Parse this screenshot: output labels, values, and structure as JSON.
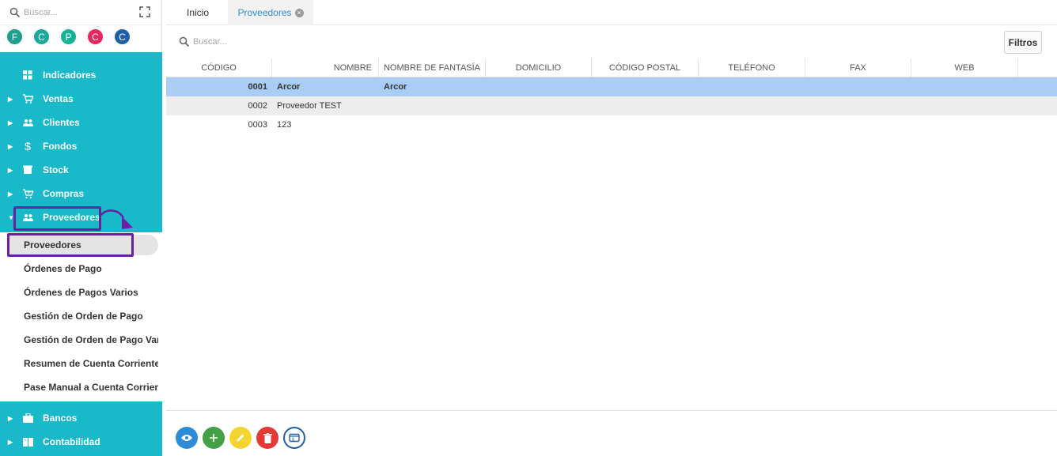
{
  "sidebar": {
    "search_placeholder": "Buscar...",
    "avatars": [
      {
        "letter": "F",
        "color": "#1e9e8b"
      },
      {
        "letter": "C",
        "color": "#19a89a"
      },
      {
        "letter": "P",
        "color": "#17b197"
      },
      {
        "letter": "C",
        "color": "#e8265e"
      },
      {
        "letter": "C",
        "color": "#1f5fa8"
      }
    ],
    "menu": [
      {
        "label": "Indicadores",
        "icon": "dashboard-icon"
      },
      {
        "label": "Ventas",
        "icon": "cart-icon"
      },
      {
        "label": "Clientes",
        "icon": "people-icon"
      },
      {
        "label": "Fondos",
        "icon": "dollar-icon"
      },
      {
        "label": "Stock",
        "icon": "box-icon"
      },
      {
        "label": "Compras",
        "icon": "cart-plus-icon"
      },
      {
        "label": "Proveedores",
        "icon": "people-icon"
      },
      {
        "label": "Bancos",
        "icon": "briefcase-icon"
      },
      {
        "label": "Contabilidad",
        "icon": "book-icon"
      }
    ],
    "submenu": [
      {
        "label": "Proveedores"
      },
      {
        "label": "Órdenes de Pago"
      },
      {
        "label": "Órdenes de Pagos Varios"
      },
      {
        "label": "Gestión de Orden de Pago"
      },
      {
        "label": "Gestión de Orden de Pago Varios"
      },
      {
        "label": "Resumen de Cuenta Corriente"
      },
      {
        "label": "Pase Manual a Cuenta Corriente"
      }
    ],
    "accent_color": "#1ab9c9",
    "highlight_color": "#6b1fa2"
  },
  "tabs": {
    "home": "Inicio",
    "active": "Proveedores"
  },
  "toolbar": {
    "search_placeholder": "Buscar...",
    "filter_label": "Filtros"
  },
  "grid": {
    "columns": [
      "CÓDIGO",
      "NOMBRE",
      "NOMBRE DE FANTASÍA",
      "DOMICILIO",
      "CÓDIGO POSTAL",
      "TELÉFONO",
      "FAX",
      "WEB"
    ],
    "rows": [
      {
        "codigo": "0001",
        "nombre": "Arcor",
        "fantasia": "Arcor"
      },
      {
        "codigo": "0002",
        "nombre": "Proveedor TEST",
        "fantasia": ""
      },
      {
        "codigo": "0003",
        "nombre": "123",
        "fantasia": ""
      }
    ],
    "selected_color": "#a9cdf5"
  },
  "actions": [
    {
      "name": "view-button",
      "icon": "eye-icon",
      "color": "#2e8bd6"
    },
    {
      "name": "add-button",
      "icon": "plus-icon",
      "color": "#43a047"
    },
    {
      "name": "edit-button",
      "icon": "pencil-icon",
      "color": "#f4d430"
    },
    {
      "name": "delete-button",
      "icon": "trash-icon",
      "color": "#e53935"
    },
    {
      "name": "payment-button",
      "icon": "wallet-icon",
      "color": "#1f5fa8"
    }
  ]
}
